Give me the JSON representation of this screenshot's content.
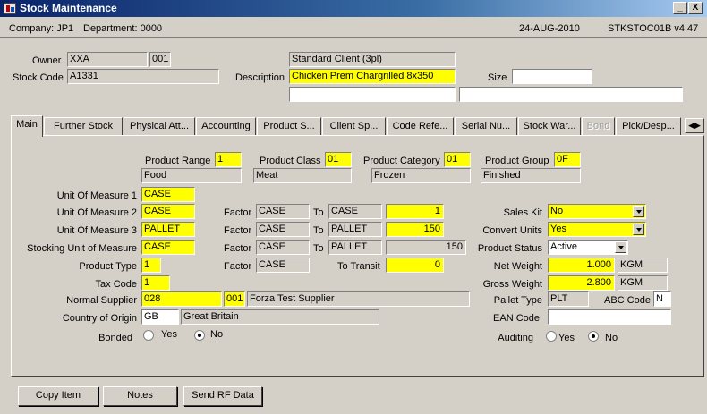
{
  "window": {
    "title": "Stock Maintenance",
    "minimize": "_",
    "close": "X"
  },
  "info": {
    "company": "Company: JP1",
    "department": "Department: 0000",
    "date": "24-AUG-2010",
    "form_id": "STKSTOC01B v4.47"
  },
  "header": {
    "owner_label": "Owner",
    "owner_value": "XXA",
    "owner_code": "001",
    "client_name": "Standard Client (3pl)",
    "stock_code_label": "Stock Code",
    "stock_code_value": "A1331",
    "description_label": "Description",
    "description_value": "Chicken Prem Chargrilled 8x350",
    "size_label": "Size",
    "size_value": ""
  },
  "tabs": [
    "Main",
    "Further Stock",
    "Physical Att...",
    "Accounting",
    "Product S...",
    "Client Sp...",
    "Code Refe...",
    "Serial Nu...",
    "Stock War...",
    "Bond",
    "Pick/Desp..."
  ],
  "tab_arrows": "◀▶",
  "main": {
    "product_range_label": "Product Range",
    "product_range": "1",
    "product_range_desc": "Food",
    "product_class_label": "Product Class",
    "product_class": "01",
    "product_class_desc": "Meat",
    "product_category_label": "Product Category",
    "product_category": "01",
    "product_category_desc": "Frozen",
    "product_group_label": "Product Group",
    "product_group": "0F",
    "product_group_desc": "Finished",
    "uom1_label": "Unit Of Measure 1",
    "uom1": "CASE",
    "uom2_label": "Unit Of Measure 2",
    "uom2": "CASE",
    "uom3_label": "Unit Of Measure 3",
    "uom3": "PALLET",
    "stocking_uom_label": "Stocking Unit of Measure",
    "stocking_uom": "CASE",
    "product_type_label": "Product Type",
    "product_type": "1",
    "tax_code_label": "Tax Code",
    "tax_code": "1",
    "factor_label": "Factor",
    "to_label": "To",
    "f2_from": "CASE",
    "f2_to": "CASE",
    "f2_val": "1",
    "f3_from": "CASE",
    "f3_to": "PALLET",
    "f3_val": "150",
    "fs_from": "CASE",
    "fs_to": "PALLET",
    "fs_val": "150",
    "fp_from": "CASE",
    "to_transit_label": "To Transit",
    "to_transit": "0",
    "normal_supplier_label": "Normal Supplier",
    "normal_supplier": "028",
    "supplier_branch": "001",
    "supplier_name": "Forza Test Supplier",
    "country_label": "Country of Origin",
    "country_code": "GB",
    "country_name": "Great Britain",
    "bonded_label": "Bonded",
    "yes_label": "Yes",
    "no_label": "No",
    "sales_kit_label": "Sales Kit",
    "sales_kit": "No",
    "convert_units_label": "Convert Units",
    "convert_units": "Yes",
    "product_status_label": "Product Status",
    "product_status": "Active",
    "net_weight_label": "Net Weight",
    "net_weight": "1.000",
    "net_weight_unit": "KGM",
    "gross_weight_label": "Gross Weight",
    "gross_weight": "2.800",
    "gross_weight_unit": "KGM",
    "pallet_type_label": "Pallet Type",
    "pallet_type": "PLT",
    "abc_code_label": "ABC Code",
    "abc_code": "N",
    "ean_code_label": "EAN Code",
    "ean_code": "",
    "auditing_label": "Auditing"
  },
  "buttons": {
    "copy_item": "Copy Item",
    "notes": "Notes",
    "send_rf": "Send RF Data"
  }
}
